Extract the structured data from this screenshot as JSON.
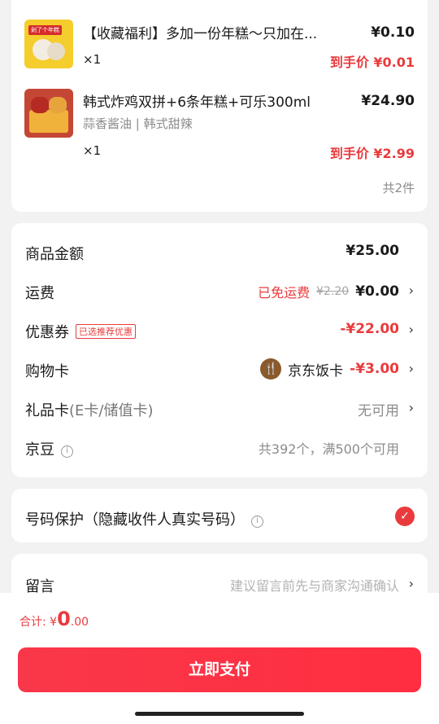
{
  "products": [
    {
      "thumb_badge": "剁了个年糕",
      "title": "【收藏福利】多加一份年糕～只加在...",
      "price": "¥0.10",
      "qty": "×1",
      "final_price": "到手价 ¥0.01"
    },
    {
      "title": "韩式炸鸡双拼+6条年糕+可乐300ml",
      "spec": "蒜香酱油 | 韩式甜辣",
      "price": "¥24.90",
      "qty": "×1",
      "final_price": "到手价 ¥2.99"
    }
  ],
  "item_count": "共2件",
  "fees": {
    "goods_amount": {
      "label": "商品金额",
      "value": "¥25.00"
    },
    "shipping": {
      "label": "运费",
      "note": "已免运费",
      "original": "¥2.20",
      "value": "¥0.00"
    },
    "coupon": {
      "label": "优惠券",
      "tag": "已选推荐优惠",
      "value": "-¥22.00"
    },
    "shopping_card": {
      "label": "购物卡",
      "card_name": "京东饭卡",
      "value": "-¥3.00"
    },
    "gift_card": {
      "label": "礼品卡",
      "sublabel": "(E卡/储值卡)",
      "value": "无可用"
    },
    "jingdou": {
      "label": "京豆",
      "value": "共392个，满500个可用"
    }
  },
  "privacy": {
    "label": "号码保护（隐藏收件人真实号码）"
  },
  "message": {
    "label": "留言",
    "placeholder": "建议留言前先与商家沟通确认"
  },
  "bottom": {
    "total_label": "合计: ",
    "currency": "¥",
    "total_int": "0",
    "total_dec": ".00",
    "pay_button": "立即支付"
  },
  "colors": {
    "accent": "#e93b3d",
    "button": "#fa3447"
  },
  "icons": [
    "chevron-right-icon",
    "info-icon",
    "check-circle-icon",
    "fork-spoon-icon"
  ]
}
